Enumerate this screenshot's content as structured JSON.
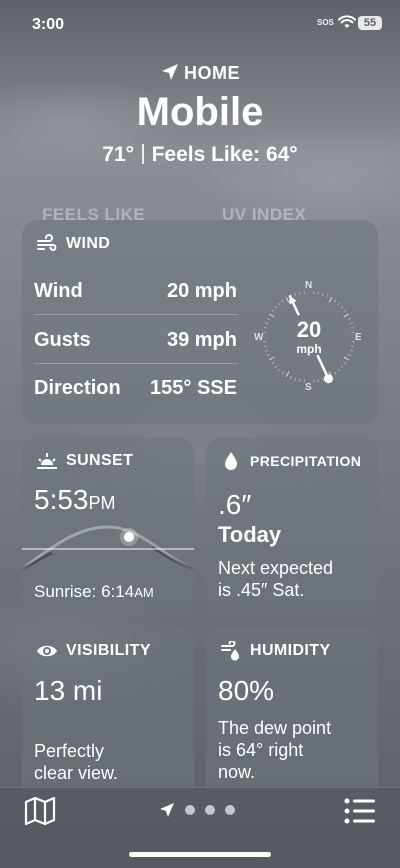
{
  "status_bar": {
    "time": "3:00",
    "sos": "SOS",
    "battery": "55"
  },
  "header": {
    "location_label": "HOME",
    "city": "Mobile",
    "temperature": "71°",
    "feels_like": "Feels Like: 64°"
  },
  "behind_cards": {
    "left": "FEELS LIKE",
    "right": "UV INDEX"
  },
  "wind": {
    "title": "WIND",
    "rows": [
      {
        "label": "Wind",
        "value": "20 mph"
      },
      {
        "label": "Gusts",
        "value": "39 mph"
      },
      {
        "label": "Direction",
        "value": "155° SSE"
      }
    ],
    "compass": {
      "speed": "20",
      "unit": "mph",
      "n": "N",
      "e": "E",
      "s": "S",
      "w": "W",
      "direction_degrees": 155
    }
  },
  "sunset": {
    "title": "SUNSET",
    "time": "5:53",
    "ampm": "PM",
    "sunrise_label": "Sunrise: 6:14",
    "sunrise_ampm": "AM"
  },
  "precipitation": {
    "title": "PRECIPITATION",
    "amount": ".6″",
    "period": "Today",
    "line1": "Next expected",
    "line2": "is .45″ Sat."
  },
  "visibility": {
    "title": "VISIBILITY",
    "value": "13 mi",
    "line1": "Perfectly",
    "line2": "clear view."
  },
  "humidity": {
    "title": "HUMIDITY",
    "value": "80%",
    "line1": "The dew point",
    "line2": "is 64° right",
    "line3": "now."
  }
}
